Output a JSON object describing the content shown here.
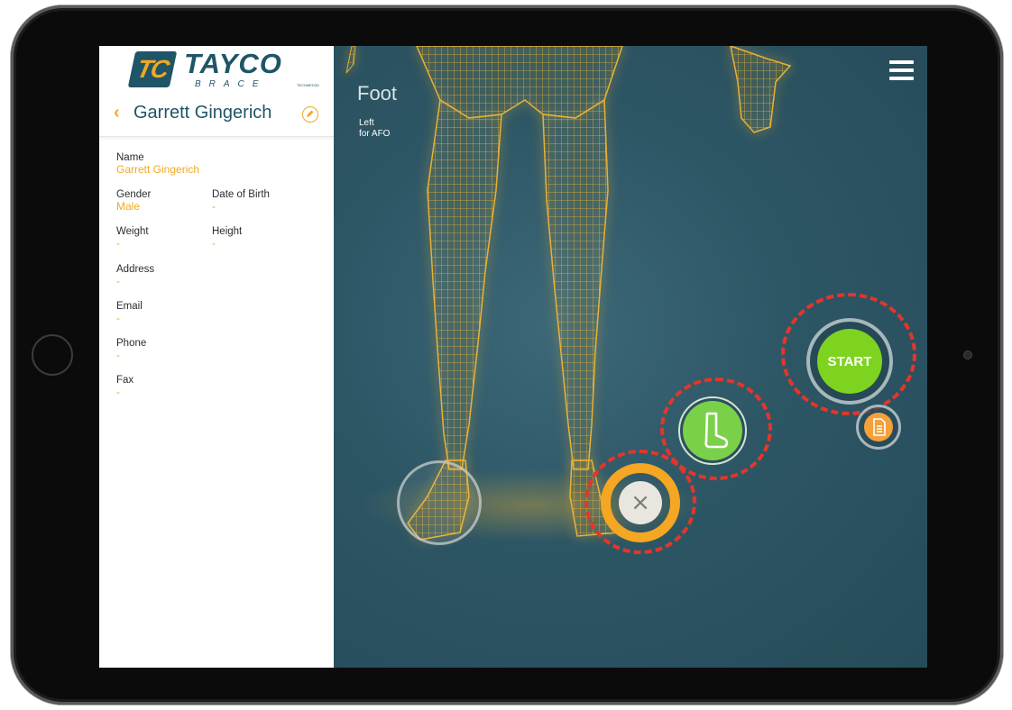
{
  "app": {
    "logo_word": "TAYCO",
    "logo_mark": "TC",
    "logo_sub": "BRACE",
    "tech_tag": "TECHMED3D"
  },
  "patient": {
    "back_icon": "chevron-left-icon",
    "name": "Garrett Gingerich",
    "edit_icon": "pencil-circle-icon",
    "fields": {
      "name_label": "Name",
      "name_value": "Garrett Gingerich",
      "gender_label": "Gender",
      "gender_value": "Male",
      "dob_label": "Date of Birth",
      "dob_value": "-",
      "weight_label": "Weight",
      "weight_value": "-",
      "height_label": "Height",
      "height_value": "-",
      "address_label": "Address",
      "address_value": "-",
      "email_label": "Email",
      "email_value": "-",
      "phone_label": "Phone",
      "phone_value": "-",
      "fax_label": "Fax",
      "fax_value": "-"
    }
  },
  "scan": {
    "region_title": "Foot",
    "side": "Left",
    "purpose": "for AFO",
    "start_label": "START",
    "cancel_glyph": "×",
    "menu_icon": "hamburger-menu-icon",
    "foot_icon": "foot-sock-icon",
    "doc_icon": "document-icon"
  },
  "colors": {
    "accent": "#f0a823",
    "brand": "#1f5566",
    "start": "#7ed321",
    "highlight_ring": "#e3362a",
    "mesh": "#f2b632"
  }
}
